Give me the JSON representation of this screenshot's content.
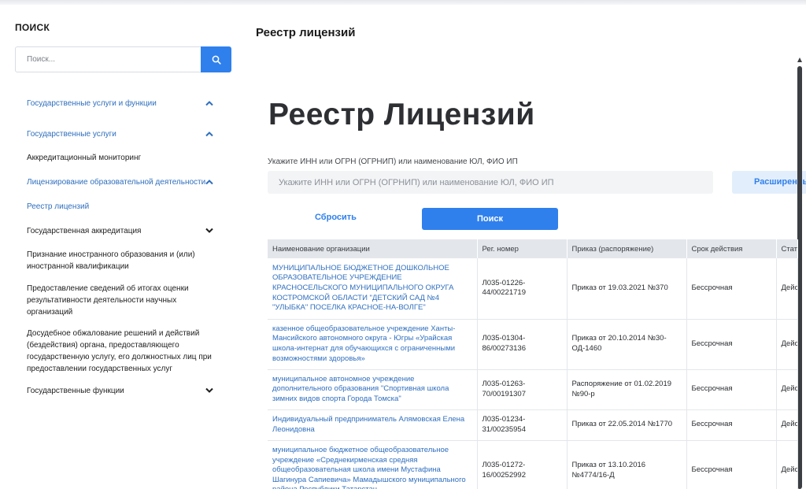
{
  "sidebar": {
    "title": "ПОИСК",
    "search_placeholder": "Поиск...",
    "items": [
      {
        "label": "Государственные услуги и функции",
        "style": "link",
        "chevron": "up"
      },
      {
        "label": "Государственные услуги",
        "style": "link",
        "chevron": "up"
      },
      {
        "label": "Аккредитационный мониторинг",
        "style": "dark",
        "chevron": ""
      },
      {
        "label": "Лицензирование образовательной деятельности",
        "style": "link",
        "chevron": "up"
      },
      {
        "label": "Реестр лицензий",
        "style": "link",
        "chevron": ""
      },
      {
        "label": "Государственная аккредитация",
        "style": "dark",
        "chevron": "down"
      },
      {
        "label": "Признание иностранного образования и (или) иностранной квалификации",
        "style": "dark",
        "chevron": ""
      },
      {
        "label": "Предоставление сведений об итогах оценки результативности деятельности научных организаций",
        "style": "dark",
        "chevron": ""
      },
      {
        "label": "Досудебное обжалование решений и действий (бездействия) органа, предоставляющего государственную услугу, его должностных лиц при предоставлении государственных услуг",
        "style": "dark",
        "chevron": ""
      },
      {
        "label": "Государственные функции",
        "style": "dark",
        "chevron": "down"
      }
    ]
  },
  "main": {
    "page_heading": "Реестр лицензий",
    "big_title": "Реестр Лицензий",
    "field_label": "Укажите ИНН или ОГРН (ОГРНИП) или наименование ЮЛ, ФИО ИП",
    "field_placeholder": "Укажите ИНН или ОГРН (ОГРНИП) или наименование ЮЛ, ФИО ИП",
    "advanced_label": "Расширенный поиск",
    "reset_label": "Сбросить",
    "search_label": "Поиск"
  },
  "table": {
    "headers": [
      "Наименование организации",
      "Рег. номер",
      "Приказ (распоряжение)",
      "Срок действия",
      "Статус"
    ],
    "rows": [
      {
        "org": "МУНИЦИПАЛЬНОЕ БЮДЖЕТНОЕ ДОШКОЛЬНОЕ ОБРАЗОВАТЕЛЬНОЕ УЧРЕЖДЕНИЕ КРАСНОСЕЛЬСКОГО МУНИЦИПАЛЬНОГО ОКРУГА КОСТРОМСКОЙ ОБЛАСТИ \"ДЕТСКИЙ САД №4 \"УЛЫБКА\" ПОСЕЛКА КРАСНОЕ-НА-ВОЛГЕ\"",
        "reg": "Л035-01226-44/00221719",
        "order": "Приказ от 19.03.2021 №370",
        "term": "Бессрочная",
        "status": "Действует"
      },
      {
        "org": "казенное общеобразовательное учреждение Ханты-Мансийского автономного округа - Югры «Урайская школа-интернат для обучающихся с ограниченными возможностями здоровья»",
        "reg": "Л035-01304-86/00273136",
        "order": "Приказ от 20.10.2014 №30-ОД-1460",
        "term": "Бессрочная",
        "status": "Действует"
      },
      {
        "org": "муниципальное автономное учреждение дополнительного образования \"Спортивная школа зимних видов спорта Города Томска\"",
        "reg": "Л035-01263-70/00191307",
        "order": "Распоряжение от 01.02.2019 №90-р",
        "term": "Бессрочная",
        "status": "Действует"
      },
      {
        "org": "Индивидуальный предприниматель Алямовская Елена Леонидовна",
        "reg": "Л035-01234-31/00235954",
        "order": "Приказ от 22.05.2014 №1770",
        "term": "Бессрочная",
        "status": "Действует"
      },
      {
        "org": "муниципальное бюджетное общеобразовательное учреждение «Среднекирменская средняя общеобразовательная школа имени Мустафина Шагинура Сапиевича» Мамадышского муниципального района Республики Татарстан",
        "reg": "Л035-01272-16/00252992",
        "order": "Приказ от 13.10.2016 №4774/16-Д",
        "term": "Бессрочная",
        "status": "Действует"
      }
    ]
  }
}
